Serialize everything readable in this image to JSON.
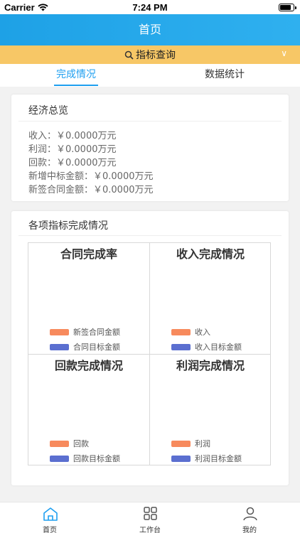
{
  "status": {
    "carrier": "Carrier",
    "time": "7:24 PM"
  },
  "header": {
    "title": "首页"
  },
  "query": {
    "label": "指标查询"
  },
  "tabs": [
    {
      "label": "完成情况"
    },
    {
      "label": "数据统计"
    }
  ],
  "economy": {
    "title": "经济总览",
    "lines": [
      "收入：￥0.0000万元",
      "利润：￥0.0000万元",
      "回款：￥0.0000万元",
      "新增中标金额：￥0.0000万元",
      "新签合同金额：￥0.0000万元"
    ]
  },
  "indicators": {
    "title": "各项指标完成情况",
    "charts": [
      {
        "title": "合同完成率",
        "legend": [
          "新签合同金额",
          "合同目标金额"
        ]
      },
      {
        "title": "收入完成情况",
        "legend": [
          "收入",
          "收入目标金额"
        ]
      },
      {
        "title": "回款完成情况",
        "legend": [
          "回款",
          "回款目标金额"
        ]
      },
      {
        "title": "利润完成情况",
        "legend": [
          "利润",
          "利润目标金额"
        ]
      }
    ]
  },
  "colors": {
    "actual": "#f78a5d",
    "target": "#5b6fd0",
    "accent": "#1e9ff0",
    "query_bg": "#f7c766"
  },
  "bottom_nav": [
    {
      "label": "首页",
      "icon": "home-icon"
    },
    {
      "label": "工作台",
      "icon": "grid-icon"
    },
    {
      "label": "我的",
      "icon": "user-icon"
    }
  ]
}
